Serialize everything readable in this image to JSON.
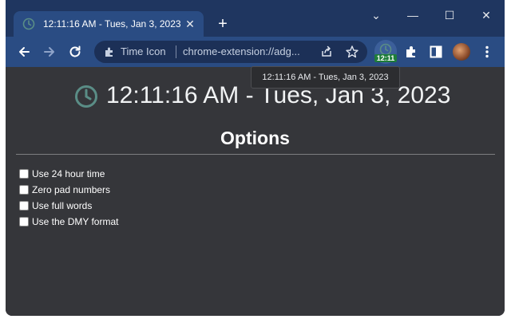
{
  "tab": {
    "title": "12:11:16 AM - Tues, Jan 3, 2023",
    "close_glyph": "✕"
  },
  "tabstrip": {
    "new_tab_glyph": "+",
    "tab_search_glyph": "⌄",
    "minimize_glyph": "—",
    "maximize_glyph": "☐",
    "close_glyph": "✕"
  },
  "toolbar": {
    "extension_name": "Time Icon",
    "url": "chrome-extension://adg...",
    "extension_badge": "12:11",
    "icons": [
      "back-icon",
      "forward-icon",
      "reload-icon",
      "puzzle-icon",
      "share-icon",
      "star-icon",
      "clock-icon",
      "extensions-icon",
      "sidepanel-icon",
      "avatar",
      "more-icon"
    ]
  },
  "tooltip": {
    "text": "12:11:16 AM - Tues, Jan 3, 2023"
  },
  "main": {
    "time_text": "12:11:16 AM - Tues, Jan 3, 2023",
    "options_title": "Options",
    "options": [
      {
        "label": "Use 24 hour time",
        "checked": false
      },
      {
        "label": "Zero pad numbers",
        "checked": false
      },
      {
        "label": "Use full words",
        "checked": false
      },
      {
        "label": "Use the DMY format",
        "checked": false
      }
    ]
  },
  "colors": {
    "tabstrip": "#1f3660",
    "toolbar": "#2a4c83",
    "page_bg": "#35363a",
    "clock_icon": "#5a8d86",
    "badge": "#1e7d3a"
  }
}
